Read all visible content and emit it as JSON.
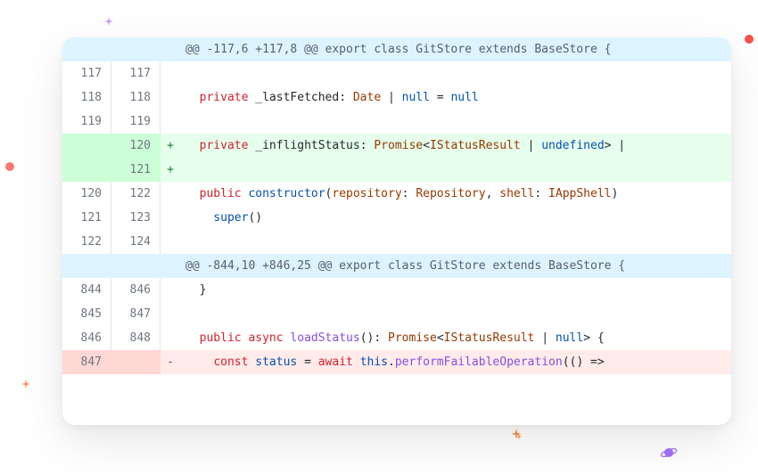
{
  "diff": {
    "hunk1": "@@ -117,6 +117,8 @@ export class GitStore extends BaseStore {",
    "hunk2": "@@ -844,10 +846,25 @@ export class GitStore extends BaseStore {",
    "lines": {
      "l117_old": "117",
      "l117_new": "117",
      "l118_old": "118",
      "l118_new": "118",
      "l119_old": "119",
      "l119_new": "119",
      "l120_new": "120",
      "l121_new": "121",
      "l120_old": "120",
      "l122_new": "122",
      "l121_old": "121",
      "l123_new": "123",
      "l122_old": "122",
      "l124_new": "124",
      "l844_old": "844",
      "l846_new": "846",
      "l845_old": "845",
      "l847_new": "847",
      "l846_old": "846",
      "l848_new": "848",
      "l847_old": "847"
    },
    "tokens": {
      "private": "private",
      "public": "public",
      "async": "async",
      "const": "const",
      "await": "await",
      "this": "this",
      "null": "null",
      "undefined": "undefined",
      "lastFetched": "_lastFetched",
      "inflightStatus": "_inflightStatus",
      "Date": "Date",
      "Promise": "Promise",
      "IStatusResult": "IStatusResult",
      "Repository": "Repository",
      "IAppShell": "IAppShell",
      "constructor": "constructor",
      "repository": "repository",
      "shell": "shell",
      "super": "super",
      "loadStatus": "loadStatus",
      "status": "status",
      "performFailableOperation": "performFailableOperation",
      "pipe": " | ",
      "eq_null": " = null",
      "lt": "<",
      "gt": ">",
      "colon_sp": ": ",
      "comma_sp": ", ",
      "open_p": "(",
      "close_p": ")",
      "open_b": " {",
      "close_b": "}",
      "eq_sp": " = ",
      "dot": ".",
      "arrow": "(() =>",
      "marker_plus": "+",
      "marker_minus": "-"
    }
  }
}
